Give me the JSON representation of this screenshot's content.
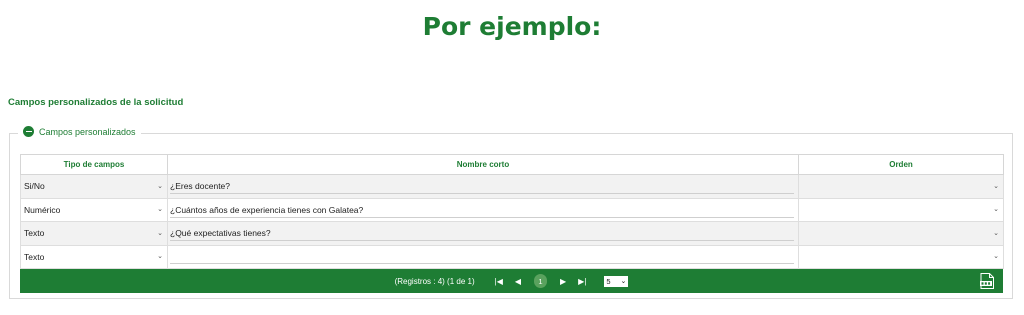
{
  "heading": "Por ejemplo:",
  "section_title": "Campos personalizados de la solicitud",
  "fieldset": {
    "legend": "Campos personalizados",
    "columns": [
      "Tipo de campos",
      "Nombre corto",
      "Orden"
    ],
    "rows": [
      {
        "tipo": "Si/No",
        "nombre": "¿Eres docente?",
        "orden": ""
      },
      {
        "tipo": "Numérico",
        "nombre": "¿Cuántos años de experiencia tienes con Galatea?",
        "orden": ""
      },
      {
        "tipo": "Texto",
        "nombre": "¿Qué expectativas tienes?",
        "orden": ""
      },
      {
        "tipo": "Texto",
        "nombre": "",
        "orden": ""
      }
    ]
  },
  "pager": {
    "info": "(Registros : 4) (1 de 1)",
    "first": "|◀",
    "prev": "◀",
    "current_page": "1",
    "next": "▶",
    "last": "▶|",
    "page_size": "5"
  },
  "icons": {
    "collapse": "minus-circle-icon",
    "dropdown": "chevron-down-icon",
    "export": "file-export-icon"
  },
  "colors": {
    "brand_green": "#1e7d34",
    "page_badge": "#5aa25e"
  }
}
